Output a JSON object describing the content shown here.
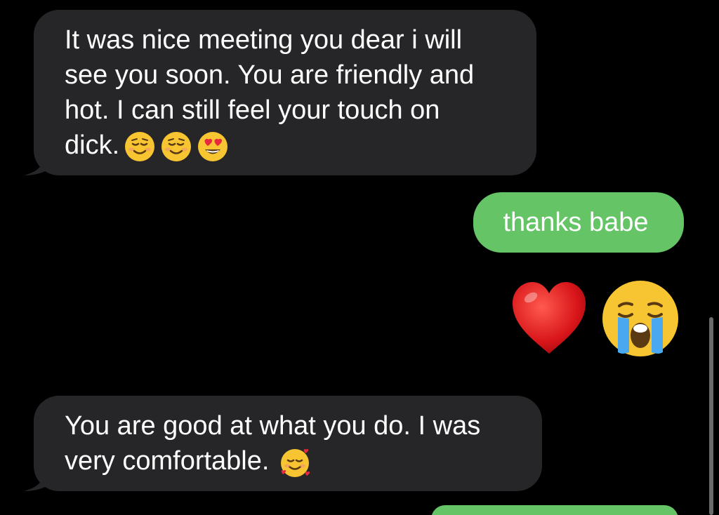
{
  "conversation": {
    "messages": [
      {
        "direction": "incoming",
        "lines": [
          "It was nice meeting you dear i will",
          "see you soon. You are friendly and",
          "hot. I can still feel your touch on",
          "dick."
        ],
        "emojis": [
          "relieved-smile-icon",
          "relieved-smile-icon",
          "heart-eyes-icon"
        ]
      },
      {
        "direction": "outgoing",
        "text": "thanks babe"
      },
      {
        "direction": "outgoing",
        "emojis": [
          "red-heart-icon",
          "loudly-crying-face-icon"
        ]
      },
      {
        "direction": "incoming",
        "lines": [
          "You are good at what you do. I was",
          "very comfortable."
        ],
        "emojis": [
          "smiling-face-with-hearts-icon"
        ]
      }
    ]
  },
  "colors": {
    "background": "#000000",
    "incoming_bubble": "#262628",
    "outgoing_bubble": "#65c466",
    "text": "#ffffff"
  }
}
